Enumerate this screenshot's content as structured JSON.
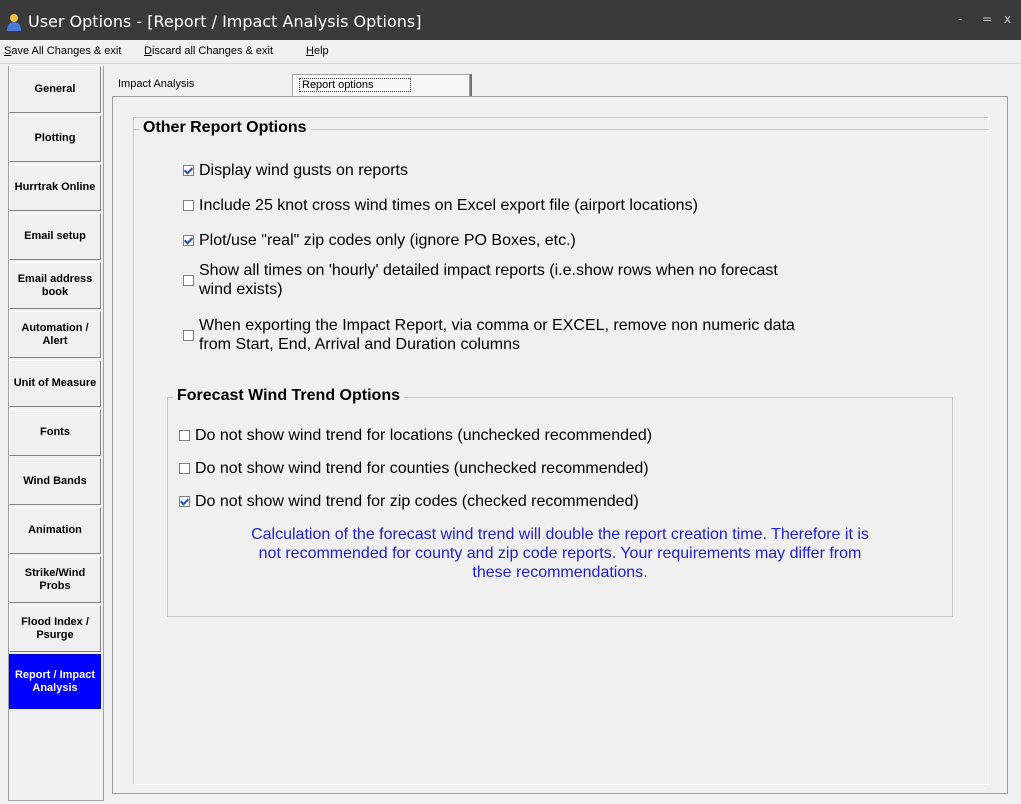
{
  "window": {
    "title": "User Options - [Report / Impact Analysis Options]",
    "controls": {
      "minimize": "-",
      "maximize": "=",
      "close": "x"
    }
  },
  "menu": {
    "items": [
      "Save All Changes & exit",
      "Discard all Changes & exit",
      "Help"
    ]
  },
  "sidebar": {
    "items": [
      {
        "label": "General"
      },
      {
        "label": "Plotting"
      },
      {
        "label": "Hurrtrak Online"
      },
      {
        "label": "Email setup"
      },
      {
        "label": "Email address book"
      },
      {
        "label": "Automation / Alert"
      },
      {
        "label": "Unit of Measure"
      },
      {
        "label": "Fonts"
      },
      {
        "label": "Wind Bands"
      },
      {
        "label": "Animation"
      },
      {
        "label": "Strike/Wind Probs"
      },
      {
        "label": "Flood Index / Psurge"
      },
      {
        "label": "Report / Impact Analysis",
        "active": true
      }
    ],
    "active_color": "#0000ff"
  },
  "tabs": [
    {
      "label": "Impact Analysis",
      "selected": false
    },
    {
      "label": "Report options",
      "selected": true
    }
  ],
  "report_options": {
    "group_title": "Other Report Options",
    "options": [
      {
        "label": "Display wind gusts on reports",
        "checked": true
      },
      {
        "label": "Include 25 knot cross wind times on Excel export file (airport  locations)",
        "checked": false
      },
      {
        "label": "Plot/use \"real\" zip codes only (ignore PO Boxes, etc.)",
        "checked": true
      },
      {
        "label_line1": "Show all times on 'hourly' detailed impact reports (i.e.show rows when no forecast",
        "label_line2": "wind exists)",
        "checked": false
      },
      {
        "label_line1": "When exporting the Impact Report, via comma or EXCEL, remove non numeric data",
        "label_line2": "from Start, End, Arrival and Duration columns",
        "checked": false
      }
    ]
  },
  "wind_trend": {
    "group_title": "Forecast Wind Trend Options",
    "options": [
      {
        "label": "Do not show wind trend for locations (unchecked recommended)",
        "checked": false
      },
      {
        "label": "Do not show wind trend for counties (unchecked recommended)",
        "checked": false
      },
      {
        "label": "Do not show wind trend for zip codes (checked recommended)",
        "checked": true
      }
    ],
    "note_lines": [
      "Calculation of the forecast wind trend will double the report creation time.  Therefore it is",
      "not recommended for county and zip code reports.  Your requirements may differ from",
      "these recommendations."
    ],
    "note_color": "#2020d0"
  }
}
